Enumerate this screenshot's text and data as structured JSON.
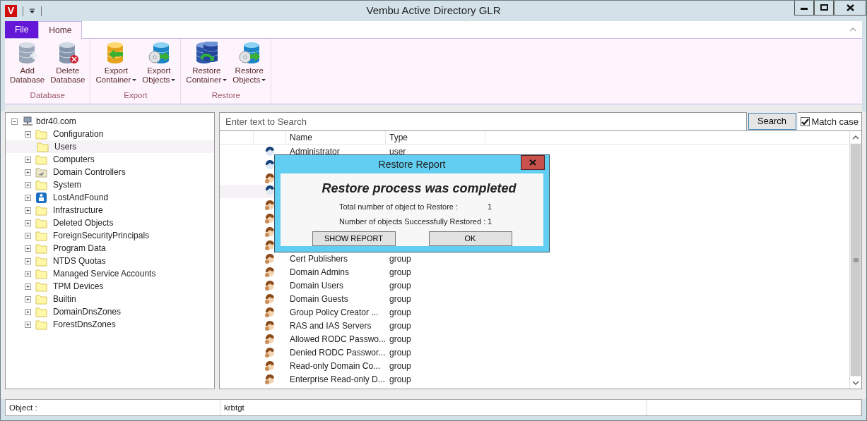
{
  "window": {
    "title": "Vembu Active Directory GLR",
    "app_badge": "V"
  },
  "ribbon_tabs": [
    {
      "label": "File",
      "kind": "file",
      "selected": false
    },
    {
      "label": "Home",
      "kind": "tab",
      "selected": true
    }
  ],
  "ribbon_groups": [
    {
      "label": "Database",
      "buttons": [
        {
          "lines": [
            "Add",
            "Database"
          ],
          "has_menu": false
        },
        {
          "lines": [
            "Delete",
            "Database"
          ],
          "has_menu": false
        }
      ]
    },
    {
      "label": "Export",
      "buttons": [
        {
          "lines": [
            "Export",
            "Container"
          ],
          "has_menu": true
        },
        {
          "lines": [
            "Export",
            "Objects"
          ],
          "has_menu": true
        }
      ]
    },
    {
      "label": "Restore",
      "buttons": [
        {
          "lines": [
            "Restore",
            "Container"
          ],
          "has_menu": true
        },
        {
          "lines": [
            "Restore",
            "Objects"
          ],
          "has_menu": true
        }
      ]
    }
  ],
  "tree": {
    "label": "bdr40.com",
    "expanded": true,
    "children": [
      {
        "label": "Configuration",
        "kind": "folder",
        "expandable": true,
        "selected": false
      },
      {
        "label": "Users",
        "kind": "folder",
        "expandable": false,
        "selected": true
      },
      {
        "label": "Computers",
        "kind": "folder",
        "expandable": true,
        "selected": false
      },
      {
        "label": "Domain Controllers",
        "kind": "controllers",
        "expandable": true,
        "selected": false
      },
      {
        "label": "System",
        "kind": "folder",
        "expandable": true,
        "selected": false
      },
      {
        "label": "LostAndFound",
        "kind": "container",
        "expandable": true,
        "selected": false
      },
      {
        "label": "Infrastructure",
        "kind": "folder",
        "expandable": true,
        "selected": false
      },
      {
        "label": "Deleted Objects",
        "kind": "folder",
        "expandable": true,
        "selected": false
      },
      {
        "label": "ForeignSecurityPrincipals",
        "kind": "folder",
        "expandable": true,
        "selected": false
      },
      {
        "label": "Program Data",
        "kind": "folder",
        "expandable": true,
        "selected": false
      },
      {
        "label": "NTDS Quotas",
        "kind": "folder",
        "expandable": true,
        "selected": false
      },
      {
        "label": "Managed Service Accounts",
        "kind": "folder",
        "expandable": true,
        "selected": false
      },
      {
        "label": "TPM Devices",
        "kind": "folder",
        "expandable": true,
        "selected": false
      },
      {
        "label": "Builtin",
        "kind": "folder",
        "expandable": true,
        "selected": false
      },
      {
        "label": "DomainDnsZones",
        "kind": "folder",
        "expandable": true,
        "selected": false
      },
      {
        "label": "ForestDnsZones",
        "kind": "folder",
        "expandable": true,
        "selected": false
      }
    ]
  },
  "search": {
    "placeholder": "Enter text to Search",
    "button": "Search",
    "match_case": {
      "label": "Match case",
      "checked": true
    }
  },
  "table": {
    "columns": [
      "Name",
      "Type"
    ],
    "rows": [
      {
        "kind": "account",
        "name": "Administrator",
        "type": "user",
        "selected": false
      },
      {
        "kind": "account",
        "selected": false
      },
      {
        "kind": "team",
        "selected": false
      },
      {
        "kind": "account",
        "selected": true
      },
      {
        "kind": "team",
        "selected": false
      },
      {
        "kind": "team",
        "selected": false
      },
      {
        "kind": "team",
        "selected": false
      },
      {
        "kind": "team",
        "selected": false
      },
      {
        "kind": "team",
        "name": "Cert Publishers",
        "type": "group",
        "selected": false
      },
      {
        "kind": "team",
        "name": "Domain Admins",
        "type": "group",
        "selected": false
      },
      {
        "kind": "team",
        "name": "Domain Users",
        "type": "group",
        "selected": false
      },
      {
        "kind": "team",
        "name": "Domain Guests",
        "type": "group",
        "selected": false
      },
      {
        "kind": "team",
        "name": "Group Policy Creator ...",
        "type": "group",
        "selected": false
      },
      {
        "kind": "team",
        "name": "RAS and IAS Servers",
        "type": "group",
        "selected": false
      },
      {
        "kind": "team",
        "name": "Allowed RODC Passwo...",
        "type": "group",
        "selected": false
      },
      {
        "kind": "team",
        "name": "Denied RODC Passwor...",
        "type": "group",
        "selected": false
      },
      {
        "kind": "team",
        "name": "Read-only Domain Co...",
        "type": "group",
        "selected": false
      },
      {
        "kind": "team",
        "name": "Enterprise Read-only D...",
        "type": "group",
        "selected": false
      }
    ]
  },
  "dialog": {
    "title": "Restore Report",
    "heading": "Restore process was completed",
    "stats": [
      {
        "label": "Total number of object to Restore :",
        "value": "1"
      },
      {
        "label": "Number of objects Successfully Restored :",
        "value": "1"
      }
    ],
    "buttons": [
      "SHOW REPORT",
      "OK"
    ]
  },
  "status_bar": {
    "label": "Object :",
    "value": "krbtgt"
  }
}
